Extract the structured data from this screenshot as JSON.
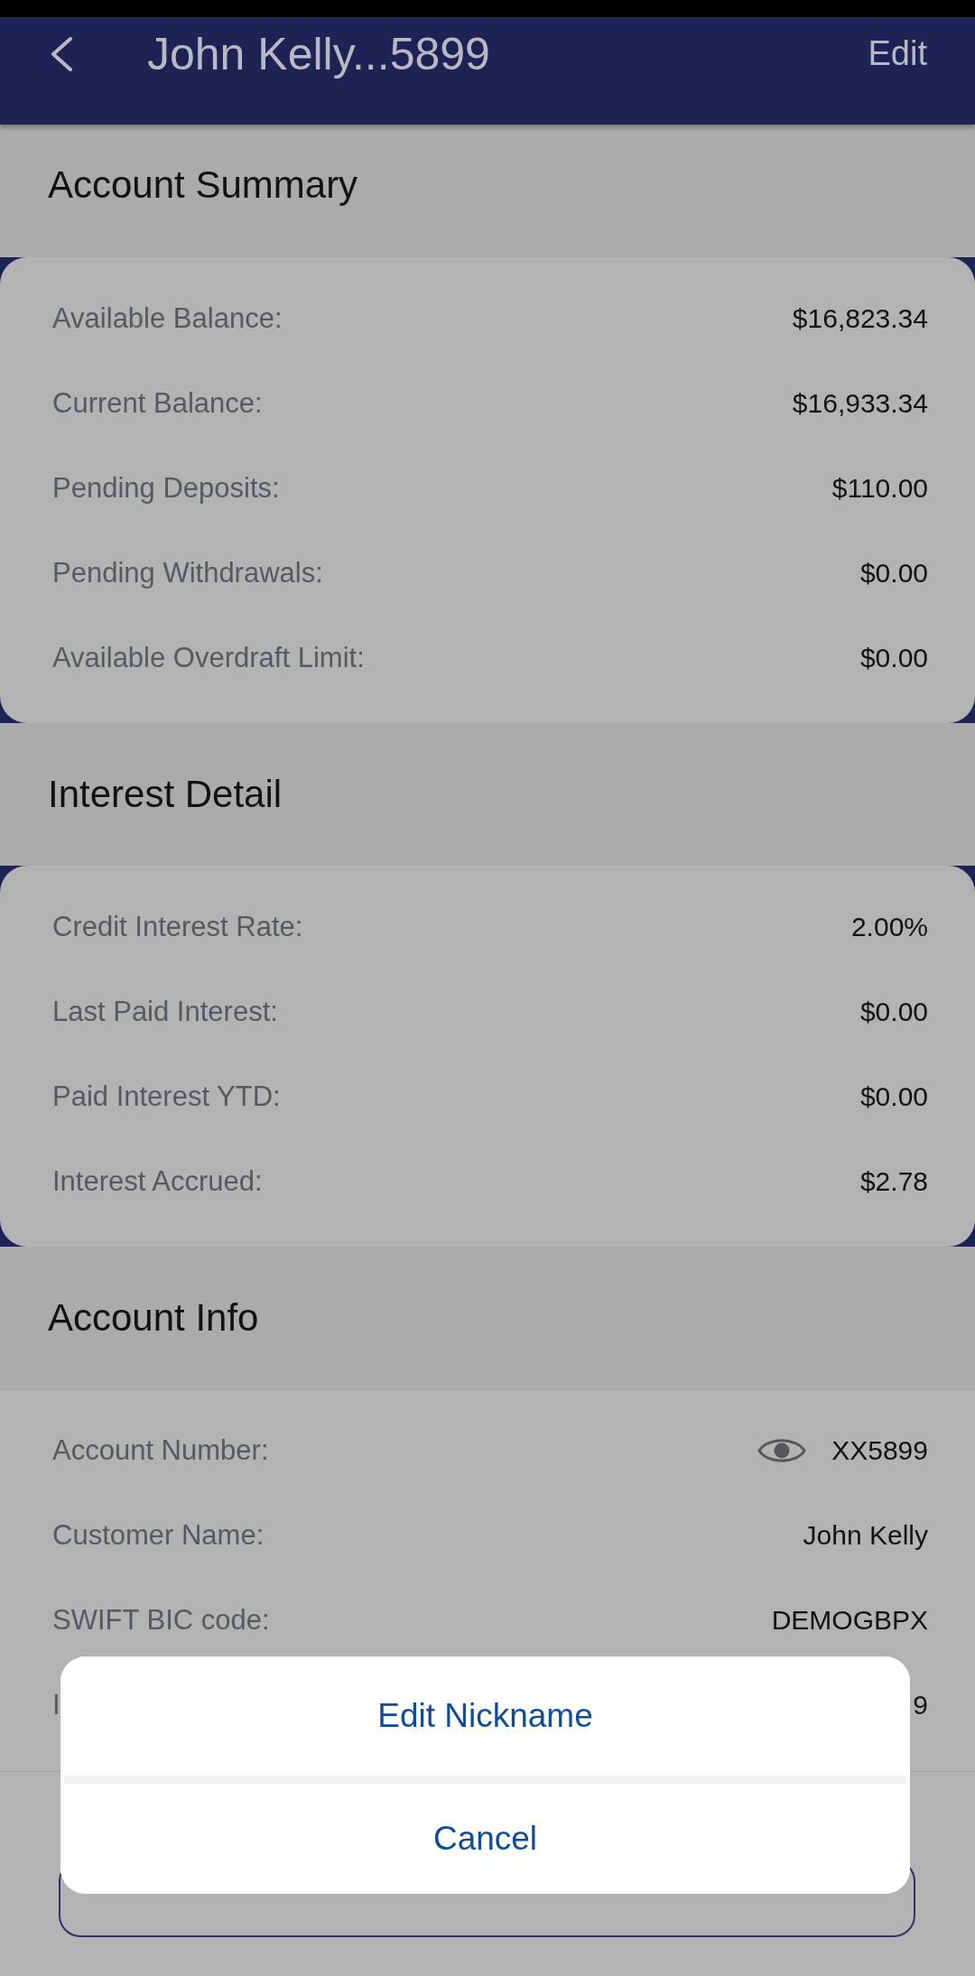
{
  "header": {
    "title": "John Kelly...5899",
    "action": "Edit"
  },
  "sections": [
    {
      "title": "Account Summary",
      "kind": "card",
      "rows": [
        {
          "label": "Available Balance:",
          "value": "$16,823.34"
        },
        {
          "label": "Current Balance:",
          "value": "$16,933.34"
        },
        {
          "label": "Pending Deposits:",
          "value": "$110.00"
        },
        {
          "label": "Pending Withdrawals:",
          "value": "$0.00"
        },
        {
          "label": "Available Overdraft Limit:",
          "value": "$0.00"
        }
      ]
    },
    {
      "title": "Interest Detail",
      "kind": "card",
      "rows": [
        {
          "label": "Credit Interest Rate:",
          "value": "2.00%"
        },
        {
          "label": "Last Paid Interest:",
          "value": "$0.00"
        },
        {
          "label": "Paid Interest YTD:",
          "value": "$0.00"
        },
        {
          "label": "Interest Accrued:",
          "value": "$2.78"
        }
      ]
    },
    {
      "title": "Account Info",
      "kind": "flat",
      "rows": [
        {
          "label": "Account Number:",
          "value": "XX5899",
          "kind": "reveal"
        },
        {
          "label": "Customer Name:",
          "value": "John Kelly",
          "kind": "plain"
        },
        {
          "label": "SWIFT BIC code:",
          "value": "DEMOGBPX",
          "kind": "plain"
        },
        {
          "label": "I",
          "value": "9",
          "kind": "plain"
        }
      ]
    }
  ],
  "action_sheet": {
    "items": [
      {
        "label": "Edit Nickname"
      },
      {
        "label": "Cancel"
      }
    ]
  }
}
